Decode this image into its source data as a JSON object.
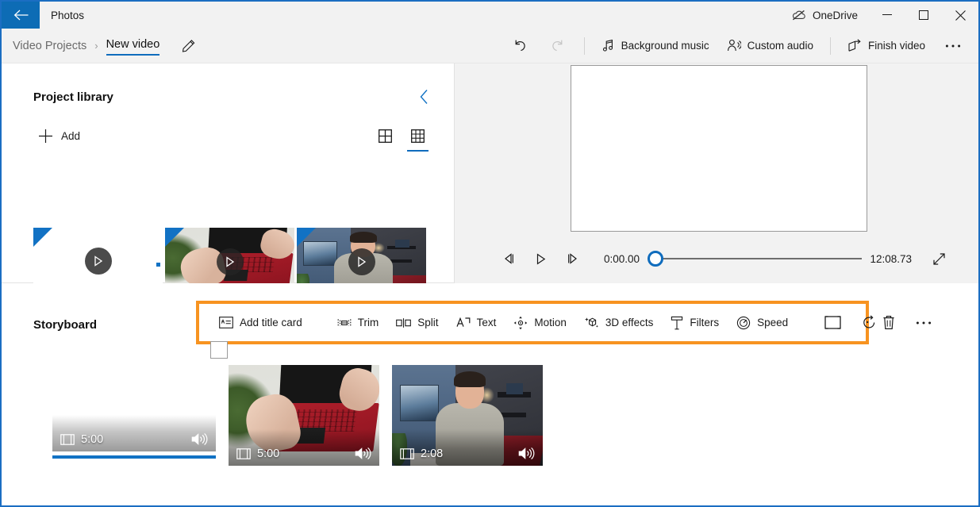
{
  "window": {
    "app_title": "Photos",
    "back_icon": "arrow-left-icon",
    "onedrive_label": "OneDrive",
    "onedrive_icon": "cloud-offline-icon",
    "minimize_icon": "minimize-icon",
    "maximize_icon": "maximize-icon",
    "close_icon": "close-icon",
    "accent_color": "#0f6cbd",
    "titlebar_back_bg": "#0d6cb5",
    "border_color": "#1b6ec2"
  },
  "breadcrumb": {
    "parent": "Video Projects",
    "separator": "›",
    "current": "New video",
    "rename_icon": "pencil-icon"
  },
  "commandbar": {
    "undo": {
      "label": "Undo",
      "icon": "undo-icon",
      "enabled": true
    },
    "redo": {
      "label": "Redo",
      "icon": "redo-icon",
      "enabled": false
    },
    "items": [
      {
        "label": "Background music",
        "icon": "music-note-icon"
      },
      {
        "label": "Custom audio",
        "icon": "person-audio-icon"
      },
      {
        "label": "Finish video",
        "icon": "share-export-icon"
      }
    ],
    "overflow_label": "See more",
    "overflow_icon": "ellipsis-icon"
  },
  "library": {
    "title": "Project library",
    "collapse_icon": "chevron-left-icon",
    "add_label": "Add",
    "add_icon": "plus-icon",
    "views": [
      {
        "name": "large-grid-view",
        "icon": "grid-2x2-icon",
        "selected": false
      },
      {
        "name": "small-grid-view",
        "icon": "grid-3x3-icon",
        "selected": true
      }
    ],
    "thumbnails": [
      {
        "name": "title-card-thumbnail",
        "kind": "blank",
        "play_icon": "play-icon",
        "badge": "blue-corner-triangle"
      },
      {
        "name": "laptop-clip-thumbnail",
        "kind": "laptop",
        "play_icon": "play-icon",
        "badge": "blue-corner-triangle"
      },
      {
        "name": "person-clip-thumbnail",
        "kind": "person",
        "play_icon": "play-icon",
        "badge": "blue-corner-triangle"
      }
    ]
  },
  "preview": {
    "frame_state": "blank-white-title-card",
    "controls": {
      "prev_frame_icon": "previous-frame-icon",
      "play_icon": "play-icon",
      "next_frame_icon": "next-frame-icon",
      "current_time": "0:00.00",
      "total_time": "12:08.73",
      "scrubber_position_percent": 0,
      "fullscreen_icon": "fullscreen-icon"
    }
  },
  "storyboard": {
    "title": "Storyboard",
    "highlight_color": "#f79320",
    "toolbar": [
      {
        "label": "Add title card",
        "icon": "title-card-icon",
        "name": "add-title-card-button"
      },
      {
        "divider": true
      },
      {
        "label": "Trim",
        "icon": "trim-icon",
        "name": "trim-button"
      },
      {
        "label": "Split",
        "icon": "split-icon",
        "name": "split-button"
      },
      {
        "label": "Text",
        "icon": "text-icon",
        "name": "text-button"
      },
      {
        "label": "Motion",
        "icon": "motion-icon",
        "name": "motion-button"
      },
      {
        "label": "3D effects",
        "icon": "cube-sparkle-icon",
        "name": "3d-effects-button"
      },
      {
        "label": "Filters",
        "icon": "filters-icon",
        "name": "filters-button"
      },
      {
        "label": "Speed",
        "icon": "speed-gauge-icon",
        "name": "speed-button"
      },
      {
        "divider": true
      },
      {
        "label": "",
        "icon": "resize-frame-icon",
        "name": "resize-button"
      },
      {
        "label": "",
        "icon": "rotate-icon",
        "name": "rotate-button"
      }
    ],
    "outside_toolbar": [
      {
        "label": "",
        "icon": "trash-icon",
        "name": "delete-button"
      },
      {
        "label": "",
        "icon": "ellipsis-icon",
        "name": "storyboard-overflow-button"
      }
    ],
    "clips": [
      {
        "name": "storyboard-clip-title-card",
        "kind": "blank",
        "duration": "5:00",
        "film_icon": "film-strip-icon",
        "audio_icon": "speaker-icon",
        "selected": true,
        "has_checkbox": true
      },
      {
        "name": "storyboard-clip-laptop",
        "kind": "laptop",
        "duration": "5:00",
        "film_icon": "film-strip-icon",
        "audio_icon": "speaker-icon",
        "selected": false,
        "has_checkbox": false
      },
      {
        "name": "storyboard-clip-person",
        "kind": "person",
        "duration": "2:08",
        "film_icon": "film-strip-icon",
        "audio_icon": "speaker-icon",
        "selected": false,
        "has_checkbox": false
      }
    ]
  }
}
